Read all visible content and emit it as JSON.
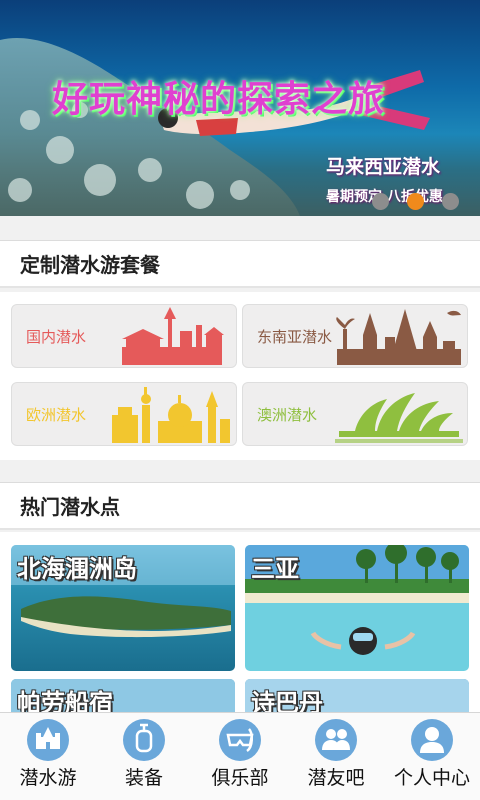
{
  "banner": {
    "headline": "好玩神秘的探索之旅",
    "subtitle": "马来西亚潜水",
    "promo": "暑期预定 八折优惠",
    "dots": [
      false,
      true,
      false
    ],
    "accent_color": "#f08a1c"
  },
  "packages": {
    "title": "定制潜水游套餐",
    "items": [
      {
        "label": "国内潜水",
        "color": "#e55a5a",
        "icon": "china-landmarks-icon"
      },
      {
        "label": "东南亚潜水",
        "color": "#8a5a44",
        "icon": "southeast-asia-temple-icon"
      },
      {
        "label": "欧洲潜水",
        "color": "#f2c62f",
        "icon": "europe-landmarks-icon"
      },
      {
        "label": "澳洲潜水",
        "color": "#8fbf3f",
        "icon": "sydney-opera-house-icon"
      }
    ]
  },
  "hot_spots": {
    "title": "热门潜水点",
    "items": [
      {
        "label": "北海涠洲岛"
      },
      {
        "label": "三亚"
      },
      {
        "label": "帕劳船宿"
      },
      {
        "label": "诗巴丹"
      }
    ]
  },
  "tabbar": {
    "items": [
      {
        "label": "潜水游",
        "icon": "castle-icon"
      },
      {
        "label": "装备",
        "icon": "oxygen-tank-icon"
      },
      {
        "label": "俱乐部",
        "icon": "diving-mask-icon"
      },
      {
        "label": "潜友吧",
        "icon": "friends-icon"
      },
      {
        "label": "个人中心",
        "icon": "person-icon"
      }
    ],
    "icon_color": "#6aa7da"
  }
}
